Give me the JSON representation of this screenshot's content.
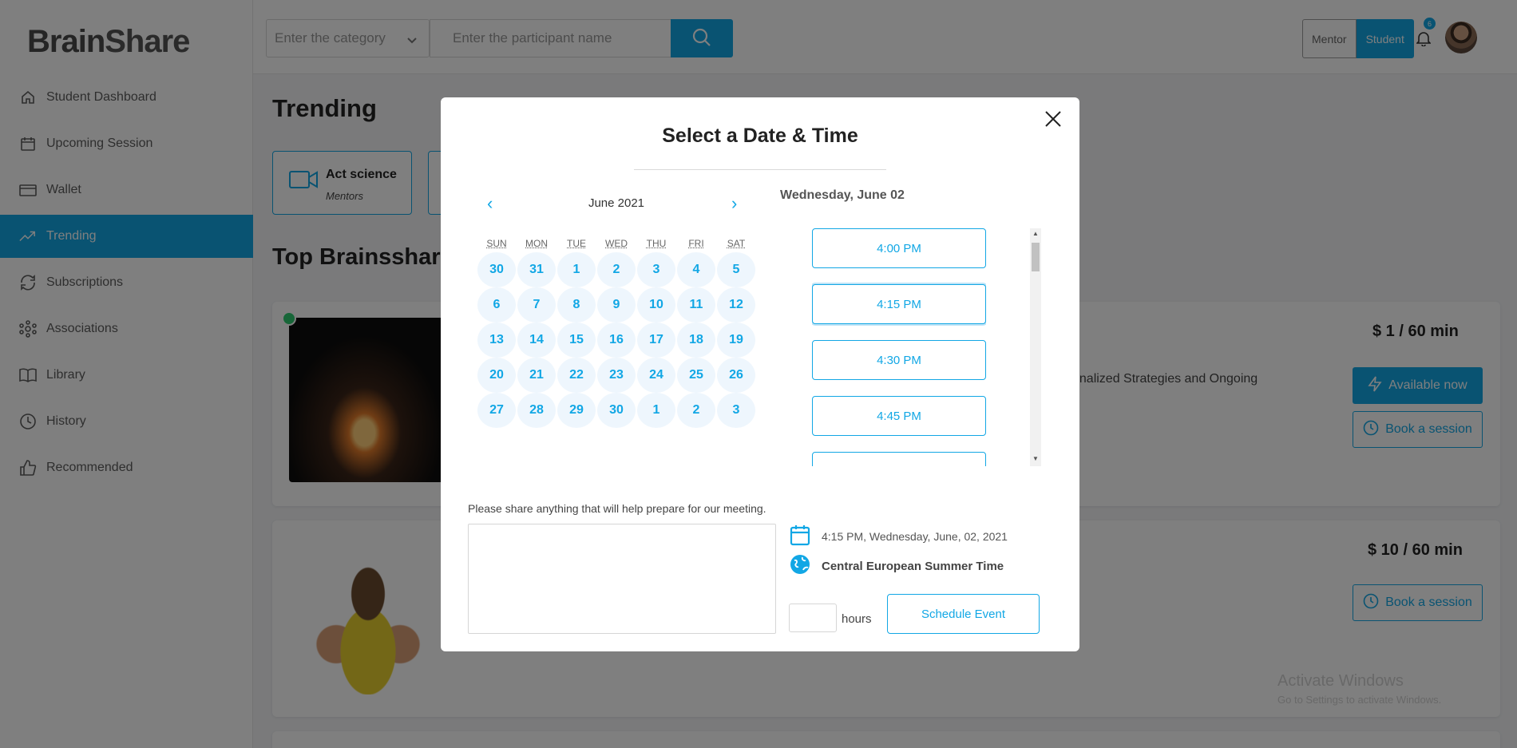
{
  "brand": {
    "logo_text_a": "Brain",
    "logo_text_b": "Share",
    "accent": "#12a7e5"
  },
  "sidebar": {
    "items": [
      {
        "label": "Student Dashboard",
        "icon": "home-icon",
        "active": false
      },
      {
        "label": "Upcoming Session",
        "icon": "calendar-icon",
        "active": false
      },
      {
        "label": "Wallet",
        "icon": "wallet-icon",
        "active": false
      },
      {
        "label": "Trending",
        "icon": "trending-icon",
        "active": true
      },
      {
        "label": "Subscriptions",
        "icon": "refresh-icon",
        "active": false
      },
      {
        "label": "Associations",
        "icon": "network-icon",
        "active": false
      },
      {
        "label": "Library",
        "icon": "book-icon",
        "active": false
      },
      {
        "label": "History",
        "icon": "clock-icon",
        "active": false
      },
      {
        "label": "Recommended",
        "icon": "thumbs-up-icon",
        "active": false
      }
    ]
  },
  "topbar": {
    "category_placeholder": "Enter the category",
    "participant_placeholder": "Enter the participant name",
    "role_mentor": "Mentor",
    "role_student": "Student",
    "notification_count": "6"
  },
  "main": {
    "trending_title": "Trending",
    "categories": [
      {
        "name": "Act science",
        "sub": "Mentors"
      }
    ],
    "top_title": "Top Brainsshare",
    "mentors": [
      {
        "price": "$ 1 / 60 min",
        "desc": "sonalized Strategies and Ongoing",
        "available_label": "Available now",
        "book_label": "Book a session"
      },
      {
        "price": "$ 10 / 60 min",
        "book_label": "Book a session"
      }
    ],
    "windows_watermark": "Activate Windows",
    "windows_watermark_sub": "Go to Settings to activate Windows."
  },
  "modal": {
    "title": "Select a Date & Time",
    "month_label": "June 2021",
    "weekdays": [
      "SUN",
      "MON",
      "TUE",
      "WED",
      "THU",
      "FRI",
      "SAT"
    ],
    "days": [
      "30",
      "31",
      "1",
      "2",
      "3",
      "4",
      "5",
      "6",
      "7",
      "8",
      "9",
      "10",
      "11",
      "12",
      "13",
      "14",
      "15",
      "16",
      "17",
      "18",
      "19",
      "20",
      "21",
      "22",
      "23",
      "24",
      "25",
      "26",
      "27",
      "28",
      "29",
      "30",
      "1",
      "2",
      "3"
    ],
    "selected_date_label": "Wednesday, June 02",
    "time_slots": [
      "4:00 PM",
      "4:15 PM",
      "4:30 PM",
      "4:45 PM",
      ""
    ],
    "selected_slot": "4:15 PM",
    "note_label": "Please share anything that will help prepare for our meeting.",
    "note_value": "",
    "summary_time": "4:15 PM, Wednesday, June, 02, 2021",
    "timezone": "Central European Summer Time",
    "hours_value": "",
    "hours_label": "hours",
    "schedule_label": "Schedule Event"
  }
}
